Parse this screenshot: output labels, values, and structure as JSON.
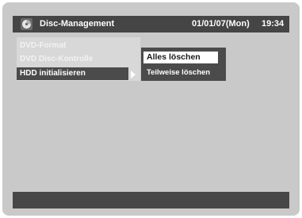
{
  "header": {
    "icon": "disc-icon",
    "title": "Disc-Management",
    "date": "01/01/07(Mon)",
    "time": "19:34"
  },
  "menu": {
    "items": [
      {
        "label": "DVD-Format",
        "state": "disabled"
      },
      {
        "label": "DVD Disc-Kontrolle",
        "state": "disabled"
      },
      {
        "label": "HDD initialisieren",
        "state": "selected",
        "has_submenu": true
      }
    ]
  },
  "submenu": {
    "items": [
      {
        "label": "Alles löschen",
        "state": "highlighted"
      },
      {
        "label": "Teilweise löschen",
        "state": "normal"
      }
    ]
  },
  "colors": {
    "background": "#c9c9c9",
    "bar": "#454545",
    "highlight": "#ffffff"
  }
}
